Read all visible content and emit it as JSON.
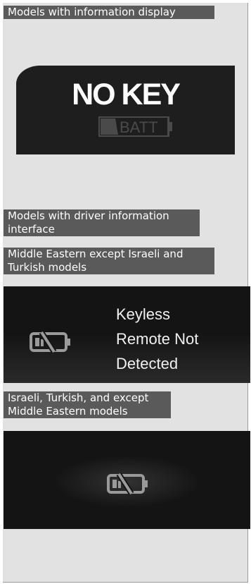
{
  "labels": {
    "info_display": "Models with information display",
    "dii_line1": "Models with driver information",
    "dii_line2": "interface",
    "me_line1": "Middle Eastern except Israeli and",
    "me_line2": "Turkish models",
    "it_line1": "Israeli, Turkish, and except",
    "it_line2": "Middle Eastern models"
  },
  "display1": {
    "message": "NO KEY",
    "battery_label": "BATT"
  },
  "display2": {
    "line1": "Keyless",
    "line2": "Remote Not",
    "line3": "Detected",
    "icon": "key-battery-low-icon"
  },
  "display3": {
    "icon": "key-battery-low-icon"
  },
  "colors": {
    "label_bg": "#5a5a5a",
    "panel_bg": "#e2e2e2",
    "screen_bg": "#1e1e1e"
  }
}
